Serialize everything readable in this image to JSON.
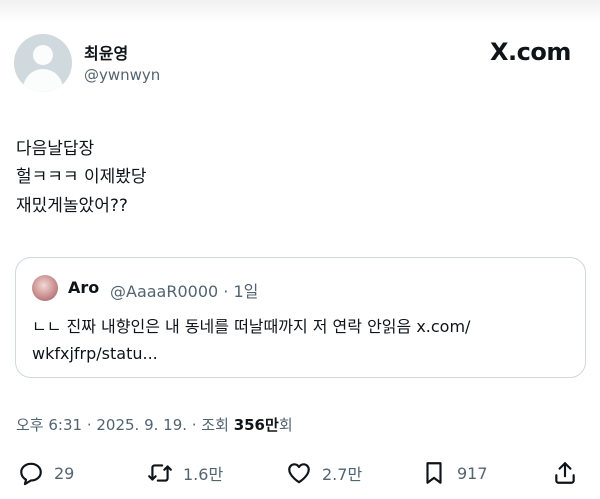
{
  "brand": "X.com",
  "author": {
    "name": "최윤영",
    "handle": "@ywnwyn"
  },
  "tweet": {
    "lines": [
      "다음날답장",
      "헐ㅋㅋㅋ 이제봤당",
      "재밌게놀았어??"
    ]
  },
  "quoted": {
    "name": "Aro",
    "handle_time": "@AaaaR0000 · 1일",
    "text_line1": "ㄴㄴ 진짜 내향인은 내 동네를 떠날때까지 저 연락 안읽음 x.com/",
    "text_line2": "wkfxjfrp/statu..."
  },
  "meta": {
    "time": "오후 6:31 · 2025. 9. 19. · 조회 ",
    "views": "356만",
    "views_suffix": "회"
  },
  "actions": {
    "replies": "29",
    "reposts": "1.6만",
    "likes": "2.7만",
    "bookmarks": "917"
  },
  "colors": {
    "text": "#0f1419",
    "secondary": "#536471",
    "border": "#cfd9de"
  }
}
